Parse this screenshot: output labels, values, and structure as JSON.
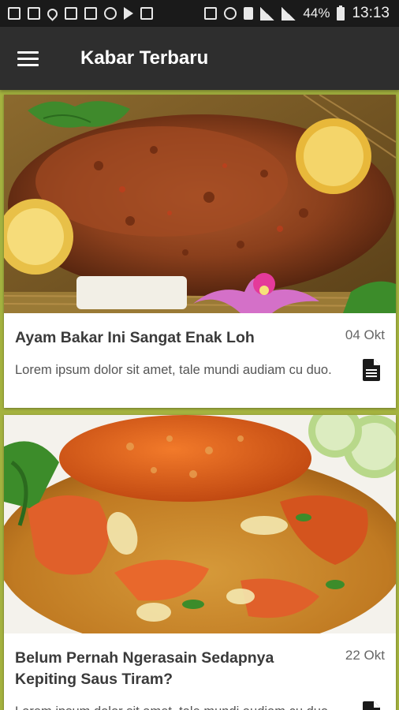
{
  "status_bar": {
    "battery": "44%",
    "time": "13:13"
  },
  "app_bar": {
    "title": "Kabar Terbaru",
    "menu_icon": "hamburger-menu-icon"
  },
  "colors": {
    "status_bar": "#1a1a1a",
    "app_bar": "#2e2e2e",
    "background": "#a4b23f",
    "card": "#ffffff"
  },
  "articles": [
    {
      "image": "grilled-chicken-photo",
      "title": "Ayam Bakar Ini Sangat Enak Loh",
      "date": "04 Okt",
      "excerpt": "Lorem ipsum dolor sit amet, tale mundi audiam cu duo.",
      "icon": "document-icon"
    },
    {
      "image": "chili-crab-photo",
      "title": "Belum Pernah Ngerasain Sedapnya Kepiting Saus Tiram?",
      "date": "22 Okt",
      "excerpt": "Lorem ipsum dolor sit amet, tale mundi audiam cu duo.",
      "icon": "document-icon"
    }
  ]
}
